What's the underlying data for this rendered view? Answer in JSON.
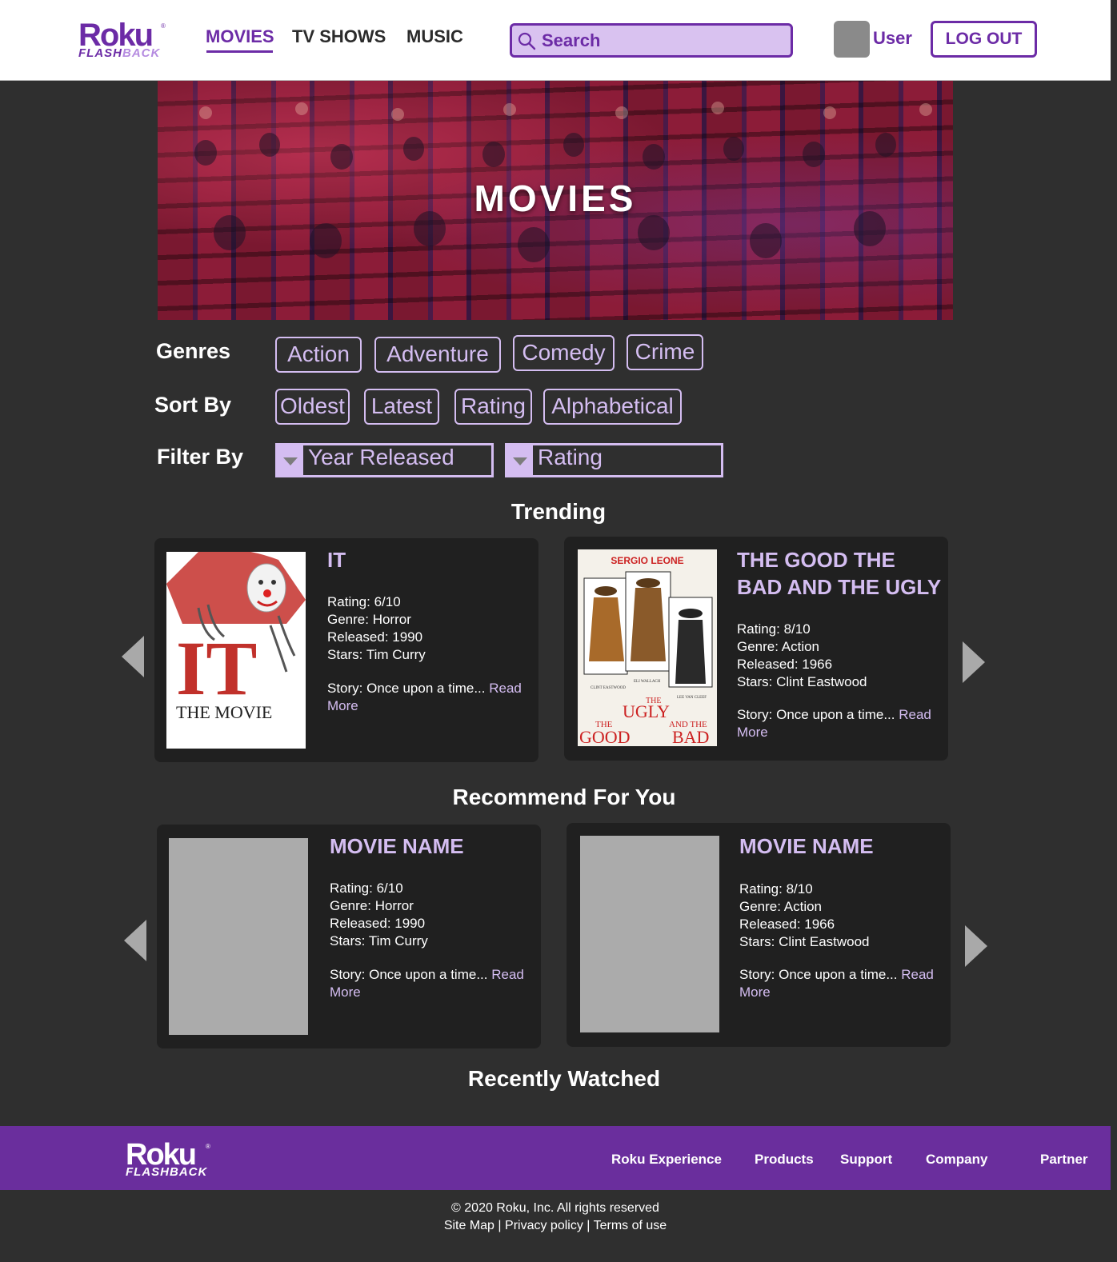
{
  "header": {
    "logo": {
      "brand": "Roku",
      "sub_a": "FLASH",
      "sub_b": "BACK"
    },
    "nav": [
      "MOVIES",
      "TV SHOWS",
      "MUSIC"
    ],
    "search_placeholder": "Search",
    "user_label": "User",
    "logout_label": "LOG OUT"
  },
  "hero": {
    "title": "MOVIES"
  },
  "filters": {
    "genres_label": "Genres",
    "genres": [
      "Action",
      "Adventure",
      "Comedy",
      "Crime"
    ],
    "sort_label": "Sort By",
    "sorts": [
      "Oldest",
      "Latest",
      "Rating",
      "Alphabetical"
    ],
    "filter_label": "Filter By",
    "dropdowns": [
      "Year Released",
      "Rating"
    ]
  },
  "trending": {
    "title": "Trending",
    "cards": [
      {
        "title": "IT",
        "rating": "Rating: 6/10",
        "genre": "Genre: Horror",
        "released": "Released: 1990",
        "stars": "Stars: Tim Curry",
        "story": "Story: Once upon a time...",
        "read_more": "Read More",
        "poster": {
          "headline": "IT",
          "subtitle": "THE MOVIE"
        }
      },
      {
        "title": "THE GOOD THE BAD AND THE UGLY",
        "rating": "Rating: 8/10",
        "genre": "Genre: Action",
        "released": "Released: 1966",
        "stars": "Stars: Clint Eastwood",
        "story": "Story: Once upon a time...",
        "read_more": "Read More",
        "poster": {
          "director": "SERGIO LEONE",
          "words": [
            "THE",
            "GOOD",
            "THE",
            "UGLY",
            "AND THE",
            "BAD"
          ],
          "cast": [
            "CLINT EASTWOOD",
            "ELI WALLACH",
            "LEE VAN CLEEF"
          ]
        }
      }
    ]
  },
  "recommend": {
    "title": "Recommend For You",
    "cards": [
      {
        "title": "MOVIE NAME",
        "rating": "Rating: 6/10",
        "genre": "Genre: Horror",
        "released": "Released: 1990",
        "stars": "Stars: Tim Curry",
        "story": "Story: Once upon a time...",
        "read_more": "Read More"
      },
      {
        "title": "MOVIE NAME",
        "rating": "Rating: 8/10",
        "genre": "Genre: Action",
        "released": "Released: 1966",
        "stars": "Stars: Clint Eastwood",
        "story": "Story: Once upon a time...",
        "read_more": "Read More"
      }
    ]
  },
  "recently_watched": {
    "title": "Recently Watched"
  },
  "footer": {
    "links": [
      "Roku Experience",
      "Products",
      "Support",
      "Company",
      "Partner"
    ],
    "copyright": "© 2020 Roku, Inc. All rights reserved",
    "legal": [
      "Site Map",
      "Privacy policy",
      "Terms of use"
    ],
    "separator": "|"
  },
  "colors": {
    "accent": "#6c2ba6",
    "light_accent": "#d4bdf1",
    "background": "#2f2f2f",
    "card": "#202020",
    "footer": "#6a2e9d"
  }
}
